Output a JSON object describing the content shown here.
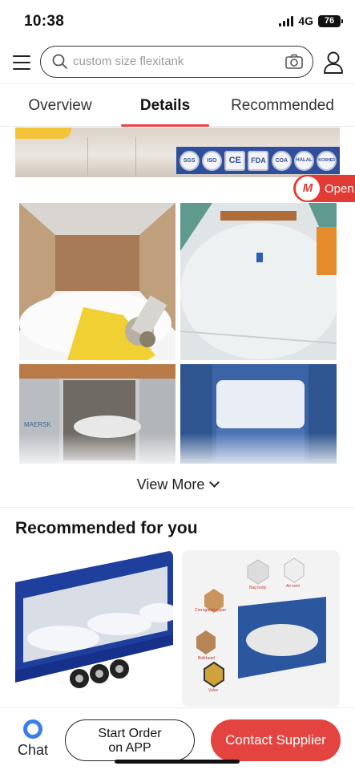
{
  "status_bar": {
    "time": "10:38",
    "network": "4G",
    "battery": "76"
  },
  "search": {
    "placeholder": "custom size flexitank",
    "icons": [
      "menu-icon",
      "search-icon",
      "camera-icon",
      "user-icon"
    ]
  },
  "tabs": [
    {
      "label": "Overview",
      "active": false
    },
    {
      "label": "Details",
      "active": true
    },
    {
      "label": "Recommended",
      "active": false
    }
  ],
  "certifications": [
    "SGS",
    "ISO",
    "CE",
    "FDA",
    "COA",
    "HALAL",
    "KOSHER"
  ],
  "floating_badge": {
    "logo": "M",
    "label": "Open"
  },
  "view_more": {
    "label": "View More"
  },
  "recommended": {
    "title": "Recommended for you",
    "component_labels": [
      "Corrugated paper",
      "Bag body",
      "Air vent",
      "Bulkhead",
      "Valve"
    ]
  },
  "bottom_bar": {
    "chat_label": "Chat",
    "start_order_line1": "Start Order",
    "start_order_line2": "on APP",
    "contact_label": "Contact Supplier"
  },
  "colors": {
    "accent_red": "#e4443f",
    "chat_blue": "#3b7de9",
    "cert_bar_blue": "#2f4f9d"
  }
}
